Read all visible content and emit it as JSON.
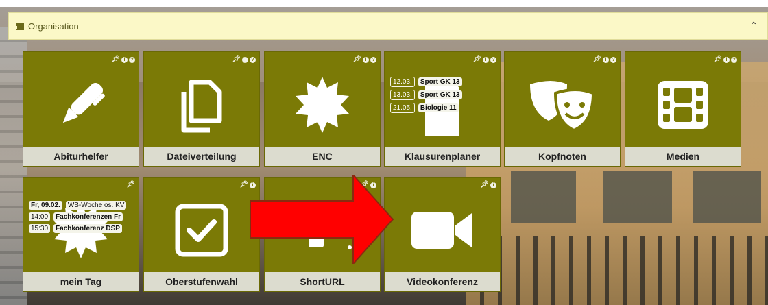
{
  "header": {
    "title": "Organisation",
    "collapse_icon": "chevron-up-icon"
  },
  "colors": {
    "tile": "#7b7a06",
    "label_bg": "#dcdccf",
    "header_bg": "#fbf8c7",
    "arrow": "#ff0000"
  },
  "tiles": [
    {
      "label": "Abiturhelfer",
      "icon": "pen-icon"
    },
    {
      "label": "Dateiverteilung",
      "icon": "copy-icon"
    },
    {
      "label": "ENC",
      "icon": "badge-icon"
    },
    {
      "label": "Klausurenplaner",
      "icon": "document-icon",
      "entries": [
        {
          "date": "12.03.",
          "text": "Sport GK 13"
        },
        {
          "date": "13.03.",
          "text": "Sport GK 13"
        },
        {
          "date": "21.05.",
          "text": "Biologie 11"
        }
      ]
    },
    {
      "label": "Kopfnoten",
      "icon": "theater-masks-icon"
    },
    {
      "label": "Medien",
      "icon": "film-icon"
    },
    {
      "label": "mein Tag",
      "icon": "badge-icon",
      "entries": [
        {
          "date": "Fr, 09.02.",
          "text": "WB-Woche os. KV"
        },
        {
          "date": "14:00",
          "text": "Fachkonferenzen Fr"
        },
        {
          "date": "15:30",
          "text": "Fachkonferenz DSP"
        }
      ]
    },
    {
      "label": "Oberstufenwahl",
      "icon": "checkbox-icon"
    },
    {
      "label": "ShortURL",
      "icon": "link-icon"
    },
    {
      "label": "Videokonferenz",
      "icon": "video-camera-icon"
    }
  ]
}
